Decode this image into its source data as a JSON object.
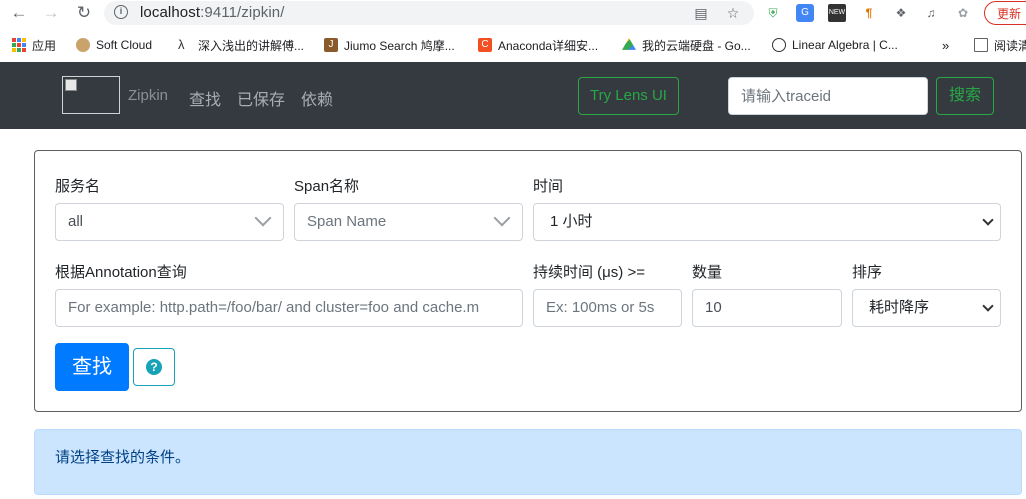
{
  "browser": {
    "url_host": "localhost",
    "url_rest": ":9411/zipkin/",
    "update_label": "更新",
    "bookmarks": [
      {
        "label": "应用"
      },
      {
        "label": "Soft Cloud"
      },
      {
        "label": "深入浅出的讲解傅..."
      },
      {
        "label": "Jiumo Search 鸠摩..."
      },
      {
        "label": "Anaconda详细安..."
      },
      {
        "label": "我的云端硬盘 - Go..."
      },
      {
        "label": "Linear Algebra | C..."
      }
    ],
    "more": "»",
    "reading_list": "阅读清"
  },
  "navbar": {
    "brand": "Zipkin",
    "links": [
      "查找",
      "已保存",
      "依赖"
    ],
    "lens_button": "Try Lens UI",
    "traceid_placeholder": "请输入traceid",
    "search_button": "搜索"
  },
  "form": {
    "service_label": "服务名",
    "service_value": "all",
    "span_label": "Span名称",
    "span_placeholder": "Span Name",
    "time_label": "时间",
    "time_value": "1 小时",
    "annotation_label": "根据Annotation查询",
    "annotation_placeholder": "For example: http.path=/foo/bar/ and cluster=foo and cache.m",
    "duration_label": "持续时间 (μs) >=",
    "duration_placeholder": "Ex: 100ms or 5s",
    "limit_label": "数量",
    "limit_value": "10",
    "sort_label": "排序",
    "sort_value": "耗时降序",
    "find_button": "查找",
    "help_icon": "?"
  },
  "alert": {
    "message": "请选择查找的条件。"
  }
}
